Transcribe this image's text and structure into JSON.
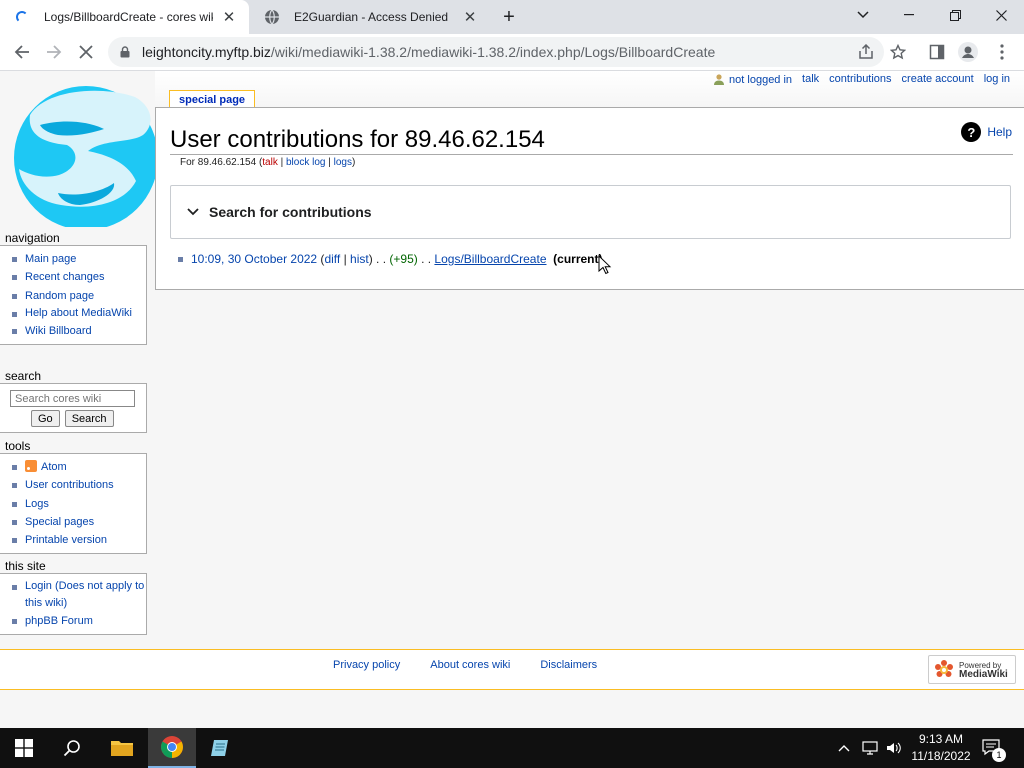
{
  "browser": {
    "tabs": [
      {
        "title": "Logs/BillboardCreate - cores wiki",
        "loading": true
      },
      {
        "title": "E2Guardian - Access Denied",
        "loading": false
      }
    ],
    "url_host": "leightoncity.myftp.biz",
    "url_path": "/wiki/mediawiki-1.38.2/mediawiki-1.38.2/index.php/Logs/BillboardCreate"
  },
  "personal_tools": {
    "not_logged_in": "not logged in",
    "talk": "talk",
    "contributions": "contributions",
    "create_account": "create account",
    "log_in": "log in"
  },
  "page_tab": "special page",
  "content": {
    "title": "User contributions for 89.46.62.154",
    "help": "Help",
    "sub_prefix": "For 89.46.62.154 (",
    "sub_talk": "talk",
    "sub_sep1": " | ",
    "sub_block_log": "block log",
    "sub_sep2": " | ",
    "sub_logs": "logs",
    "sub_suffix": ")",
    "search_label": "Search for contributions",
    "entry": {
      "timestamp": "10:09, 30 October 2022",
      "open_paren": " (",
      "diff": "diff",
      "sep": " | ",
      "hist": "hist",
      "close_paren": ") . . ",
      "size_change": "(+95)",
      "dots": " . . ",
      "page": "Logs/BillboardCreate",
      "current": "(current)"
    }
  },
  "sidebar": {
    "navigation": {
      "heading": "navigation",
      "items": [
        "Main page",
        "Recent changes",
        "Random page",
        "Help about MediaWiki",
        "Wiki Billboard"
      ]
    },
    "search": {
      "heading": "search",
      "placeholder": "Search cores wiki",
      "go": "Go",
      "search": "Search"
    },
    "tools": {
      "heading": "tools",
      "items": [
        "Atom",
        "User contributions",
        "Logs",
        "Special pages",
        "Printable version"
      ]
    },
    "this_site": {
      "heading": "this site",
      "items": [
        "Login (Does not apply to this wiki)",
        "phpBB Forum"
      ]
    }
  },
  "footer": {
    "links": [
      "Privacy policy",
      "About cores wiki",
      "Disclaimers"
    ],
    "powered_small": "Powered by",
    "powered_big": "MediaWiki"
  },
  "taskbar": {
    "time": "9:13 AM",
    "date": "11/18/2022",
    "notification_count": "1"
  }
}
